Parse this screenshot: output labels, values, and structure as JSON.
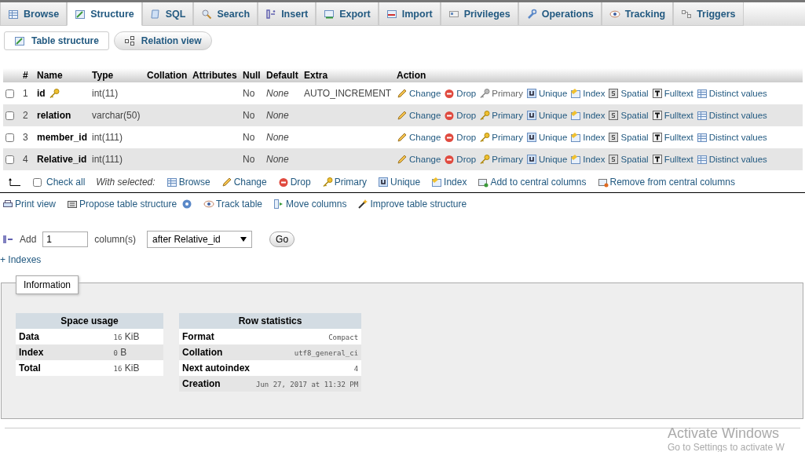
{
  "tabs": [
    {
      "label": "Browse",
      "selected": false
    },
    {
      "label": "Structure",
      "selected": true
    },
    {
      "label": "SQL",
      "selected": false
    },
    {
      "label": "Search",
      "selected": false
    },
    {
      "label": "Insert",
      "selected": false
    },
    {
      "label": "Export",
      "selected": false
    },
    {
      "label": "Import",
      "selected": false
    },
    {
      "label": "Privileges",
      "selected": false
    },
    {
      "label": "Operations",
      "selected": false
    },
    {
      "label": "Tracking",
      "selected": false
    },
    {
      "label": "Triggers",
      "selected": false
    }
  ],
  "subtabs": [
    {
      "label": "Table structure",
      "selected": true
    },
    {
      "label": "Relation view",
      "selected": false
    }
  ],
  "table": {
    "columns": [
      "#",
      "Name",
      "Type",
      "Collation",
      "Attributes",
      "Null",
      "Default",
      "Extra",
      "Action"
    ],
    "rows": [
      {
        "checked": false,
        "number": "1",
        "name": "id",
        "primary_key": true,
        "type": "int(11)",
        "null": "No",
        "default": "None",
        "extra": "AUTO_INCREMENT",
        "actions": [
          {
            "label": "Change",
            "disabled": false
          },
          {
            "label": "Drop",
            "disabled": false
          },
          {
            "label": "Primary",
            "disabled": true
          },
          {
            "label": "Unique",
            "disabled": false
          },
          {
            "label": "Index",
            "disabled": false
          },
          {
            "label": "Spatial",
            "disabled": false
          },
          {
            "label": "Fulltext",
            "disabled": false
          },
          {
            "label": "Distinct values",
            "disabled": false
          }
        ]
      },
      {
        "checked": false,
        "number": "2",
        "name": "relation",
        "primary_key": false,
        "type": "varchar(50)",
        "null": "No",
        "default": "None",
        "actions": [
          {
            "label": "Change",
            "disabled": false
          },
          {
            "label": "Drop",
            "disabled": false
          },
          {
            "label": "Primary",
            "disabled": false
          },
          {
            "label": "Unique",
            "disabled": false
          },
          {
            "label": "Index",
            "disabled": false
          },
          {
            "label": "Spatial",
            "disabled": false
          },
          {
            "label": "Fulltext",
            "disabled": false
          },
          {
            "label": "Distinct values",
            "disabled": false
          }
        ]
      },
      {
        "checked": false,
        "number": "3",
        "name": "member_id",
        "primary_key": false,
        "type": "int(111)",
        "null": "No",
        "default": "None",
        "actions": [
          {
            "label": "Change",
            "disabled": false
          },
          {
            "label": "Drop",
            "disabled": false
          },
          {
            "label": "Primary",
            "disabled": false
          },
          {
            "label": "Unique",
            "disabled": false
          },
          {
            "label": "Index",
            "disabled": false
          },
          {
            "label": "Spatial",
            "disabled": false
          },
          {
            "label": "Fulltext",
            "disabled": false
          },
          {
            "label": "Distinct values",
            "disabled": false
          }
        ]
      },
      {
        "checked": false,
        "number": "4",
        "name": "Relative_id",
        "primary_key": false,
        "type": "int(111)",
        "null": "No",
        "default": "None",
        "actions": [
          {
            "label": "Change",
            "disabled": false
          },
          {
            "label": "Drop",
            "disabled": false
          },
          {
            "label": "Primary",
            "disabled": false
          },
          {
            "label": "Unique",
            "disabled": false
          },
          {
            "label": "Index",
            "disabled": false
          },
          {
            "label": "Spatial",
            "disabled": false
          },
          {
            "label": "Fulltext",
            "disabled": false
          },
          {
            "label": "Distinct values",
            "disabled": false
          }
        ]
      }
    ]
  },
  "bulk": {
    "check_all": {
      "label": "Check all",
      "checked": false
    },
    "with_selected": "With selected:",
    "actions": [
      "Browse",
      "Change",
      "Drop",
      "Primary",
      "Unique",
      "Index",
      "Add to central columns",
      "Remove from central columns"
    ]
  },
  "links": [
    "Print view",
    "Propose table structure",
    "Track table",
    "Move columns",
    "Improve table structure"
  ],
  "add_column": {
    "label": "Add",
    "value": "1",
    "unit": "column(s)",
    "position": "after Relative_id",
    "button": "Go"
  },
  "indexes_link": "+ Indexes",
  "information": {
    "legend": "Information",
    "space_usage": {
      "title": "Space usage",
      "rows": [
        {
          "label": "Data",
          "value": "16",
          "unit": "KiB"
        },
        {
          "label": "Index",
          "value": "0",
          "unit": "B"
        },
        {
          "label": "Total",
          "value": "16",
          "unit": "KiB"
        }
      ]
    },
    "row_statistics": {
      "title": "Row statistics",
      "rows": [
        {
          "label": "Format",
          "value": "Compact"
        },
        {
          "label": "Collation",
          "value": "utf8_general_ci"
        },
        {
          "label": "Next autoindex",
          "value": "4"
        },
        {
          "label": "Creation",
          "value": "Jun 27, 2017 at 11:32 PM"
        }
      ]
    }
  },
  "os_notice": {
    "title": "Activate Windows",
    "subtitle": "Go to Settings to activate W"
  }
}
